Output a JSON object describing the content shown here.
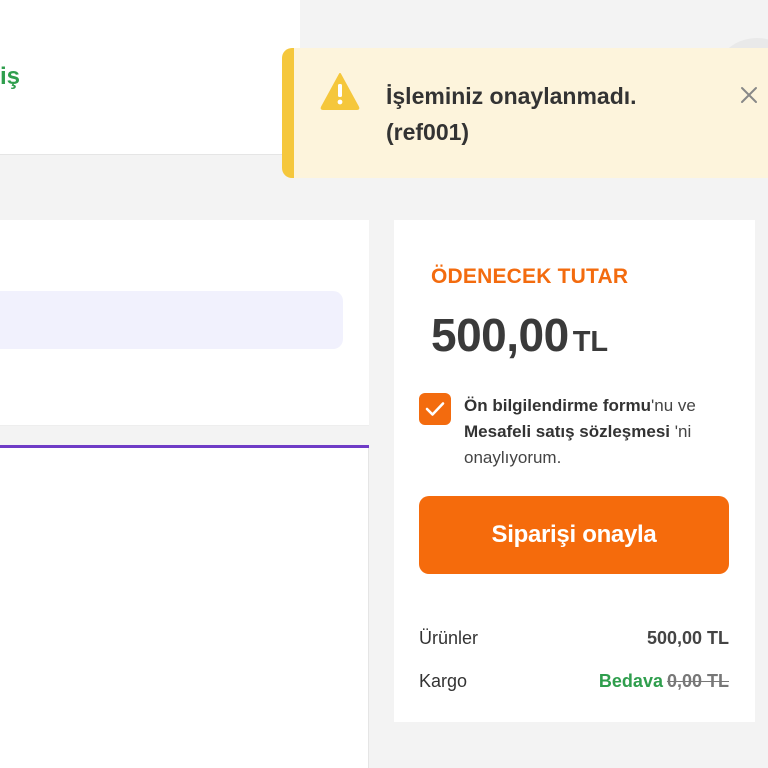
{
  "header": {
    "link_fragment": "iş"
  },
  "toast": {
    "type": "warning",
    "message_line1": "İşleminiz onaylanmadı.",
    "message_line2": "(ref001)",
    "icon": "warning-icon",
    "close_icon": "close-icon",
    "accent_color": "#f5c73c"
  },
  "summary": {
    "title": "ÖDENECEK TUTAR",
    "amount": "500,00",
    "currency": "TL",
    "consent": {
      "checked": true,
      "link1": "Ön bilgilendirme formu",
      "text1": "'nu ve",
      "link2": "Mesafeli satış sözleşmesi",
      "text2": " 'ni onaylıyorum."
    },
    "confirm_button": "Siparişi onayla",
    "rows": {
      "products_label": "Ürünler",
      "products_value": "500,00 TL",
      "shipping_label": "Kargo",
      "shipping_free": "Bedava",
      "shipping_old": "0,00 TL"
    },
    "accent_color": "#f36b0e"
  }
}
